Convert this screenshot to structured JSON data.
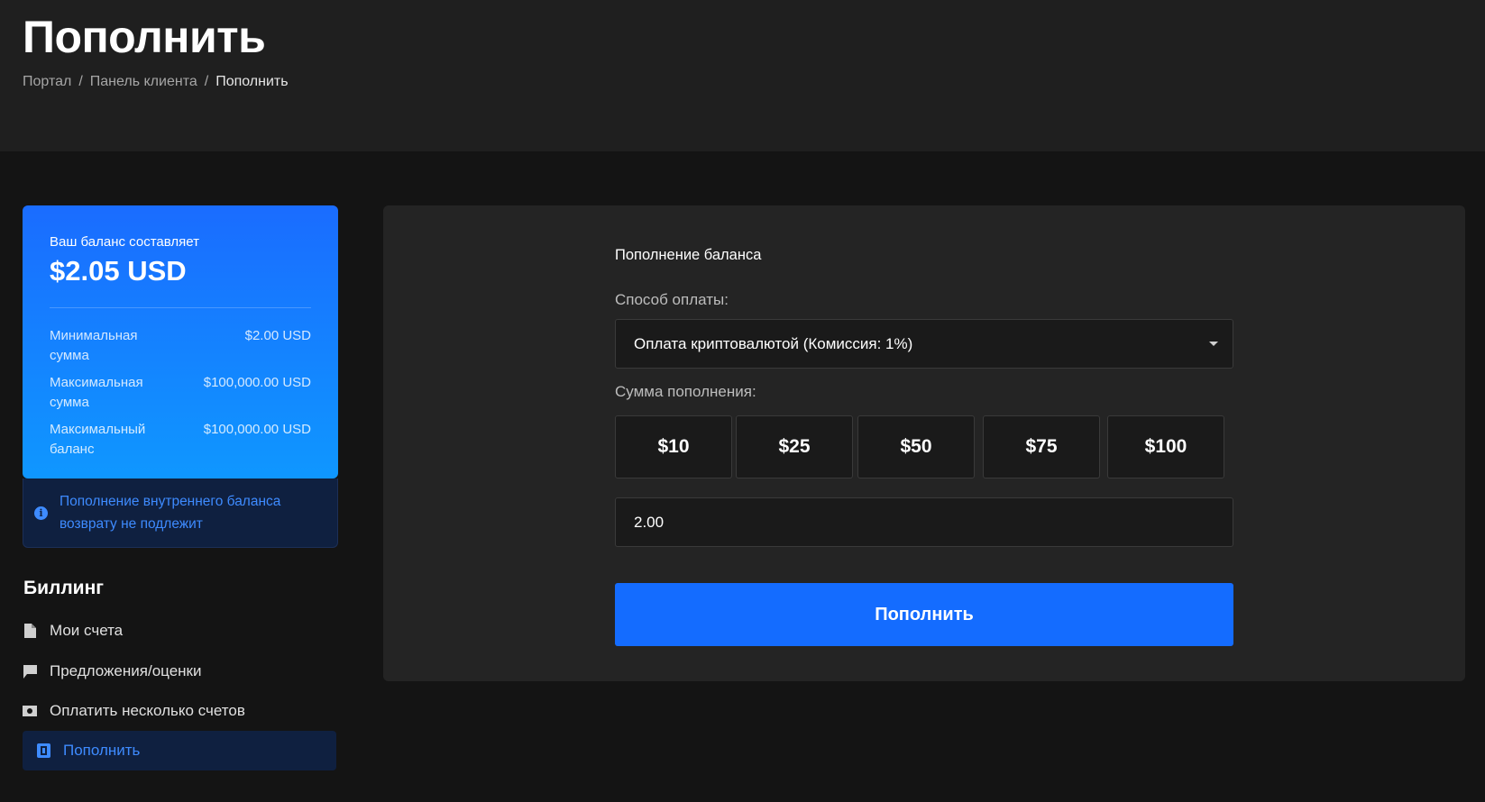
{
  "header": {
    "title": "Пополнить",
    "breadcrumb": [
      {
        "label": "Портал"
      },
      {
        "label": "Панель клиента"
      },
      {
        "label": "Пополнить"
      }
    ],
    "breadcrumb_sep": "/"
  },
  "balance": {
    "label": "Ваш баланс составляет",
    "amount": "$2.05 USD",
    "limits": [
      {
        "label": "Минимальная сумма",
        "value": "$2.00 USD"
      },
      {
        "label": "Максимальная сумма",
        "value": "$100,000.00 USD"
      },
      {
        "label": "Максимальный баланс",
        "value": "$100,000.00 USD"
      }
    ]
  },
  "notice": {
    "icon": "info-icon",
    "text": "Пополнение внутреннего баланса возврату не подлежит"
  },
  "billing": {
    "title": "Биллинг",
    "items": [
      {
        "label": "Мои счета",
        "icon": "document-icon",
        "active": false
      },
      {
        "label": "Предложения/оценки",
        "icon": "comment-icon",
        "active": false
      },
      {
        "label": "Оплатить несколько счетов",
        "icon": "money-icon",
        "active": false
      },
      {
        "label": "Пополнить",
        "icon": "deposit-icon",
        "active": true
      }
    ]
  },
  "form": {
    "section_title": "Пополнение баланса",
    "payment_label": "Способ оплаты:",
    "payment_selected": "Оплата криптовалютой (Комиссия: 1%)",
    "amount_label": "Сумма пополнения:",
    "quick_amounts": [
      "$10",
      "$25",
      "$50",
      "$75",
      "$100"
    ],
    "amount_value": "2.00",
    "submit_label": "Пополнить"
  },
  "colors": {
    "accent": "#146cff",
    "card_gradient_top": "#1a6cff",
    "card_gradient_bottom": "#0f97ff",
    "notice_text": "#3e8bff"
  }
}
